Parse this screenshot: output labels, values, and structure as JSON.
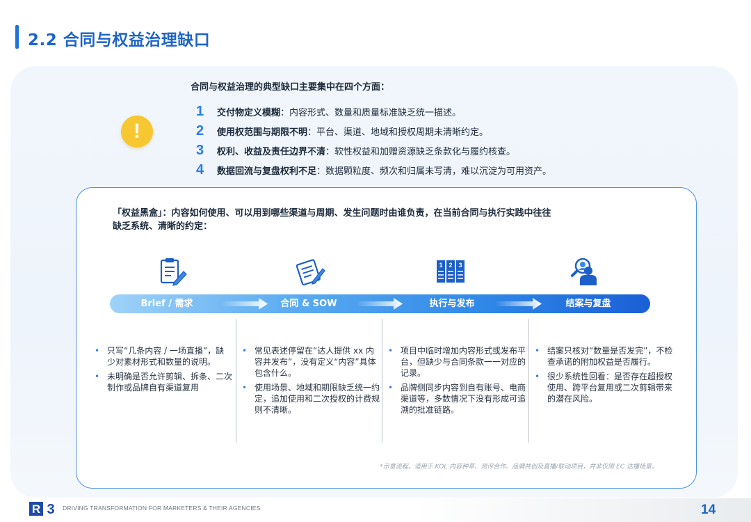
{
  "header": {
    "title": "2.2 合同与权益治理缺口"
  },
  "intro": {
    "heading": "合同与权益治理的典型缺口主要集中在四个方面：",
    "warning_icon": "exclamation-icon",
    "items": [
      {
        "num": "1",
        "term": "交付物定义模糊",
        "desc": "：内容形式、数量和质量标准缺乏统一描述。"
      },
      {
        "num": "2",
        "term": "使用权范围与期限不明",
        "desc": "：平台、渠道、地域和授权周期未清晰约定。"
      },
      {
        "num": "3",
        "term": "权利、收益及责任边界不清",
        "desc": "：软性权益和加赠资源缺乏条款化与履约核查。"
      },
      {
        "num": "4",
        "term": "数据回流与复盘权利不足",
        "desc": "：数据颗粒度、频次和归属未写清，难以沉淀为可用资产。"
      }
    ]
  },
  "card": {
    "heading_line1": "「权益黑盒」：内容如何使用、可以用到哪些渠道与周期、发生问题时由谁负责，在当前合同与执行实践中往往",
    "heading_line2": "缺乏系统、清晰的约定：",
    "stages": [
      {
        "label": "Brief / 需求",
        "icon": "clipboard-pen-icon",
        "points": [
          "只写“几条内容 / 一场直播”，缺少对素材形式和数量的说明。",
          "未明确是否允许剪辑、拆条、二次制作或品牌自有渠道复用"
        ]
      },
      {
        "label": "合同 & SOW",
        "icon": "contract-sign-icon",
        "points": [
          "常见表述停留在“达人提供 xx 内容并发布”，没有定义“内容”具体包含什么。",
          "使用场景、地域和期限缺乏统一约定，追加使用和二次授权的计费规则不清晰。"
        ]
      },
      {
        "label": "执行与发布",
        "icon": "numbered-columns-icon",
        "points": [
          "项目中临时增加内容形式或发布平台，但缺少与合同条款一一对应的记录。",
          "品牌侧同步内容到自有账号、电商渠道等，多数情况下没有形成可追溯的批准链路。"
        ]
      },
      {
        "label": "结案与复盘",
        "icon": "person-search-icon",
        "points": [
          "结案只核对“数量是否发完”，不检查承诺的附加权益是否履行。",
          "很少系统性回看：是否存在超授权使用、跨平台复用或二次剪辑带来的潜在风险。"
        ]
      }
    ],
    "footnote": "*示意流程，适用于 KOL 内容种草、测评合作、品牌共创及直播/联动项目，并非仅限 EC 达播场景。"
  },
  "footer": {
    "logo_text": "R3",
    "tagline": "DRIVING TRANSFORMATION FOR MARKETERS & THEIR AGENCIES",
    "page_number": "14"
  },
  "colors": {
    "accent": "#1e64c8",
    "number_blue": "#2a7fe0",
    "warning_yellow": "#f7c731",
    "card_border": "#4d8fe6"
  }
}
